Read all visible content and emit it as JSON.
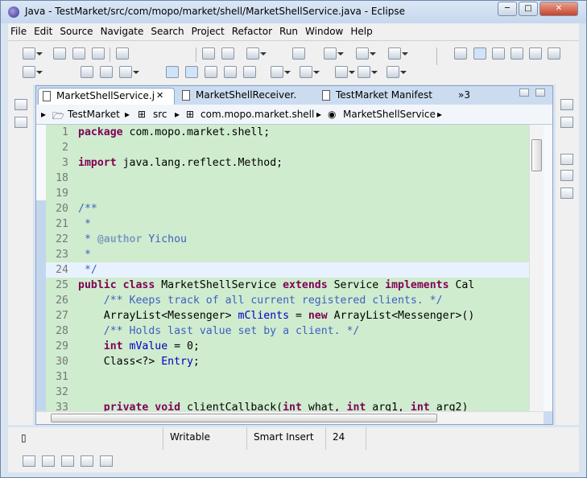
{
  "window": {
    "title": "Java - TestMarket/src/com/mopo/market/shell/MarketShellService.java - Eclipse",
    "min": "─",
    "max": "□",
    "close": "✕"
  },
  "menu": [
    "File",
    "Edit",
    "Source",
    "Navigate",
    "Search",
    "Project",
    "Refactor",
    "Run",
    "Window",
    "Help"
  ],
  "tabs": [
    {
      "label": "MarketShellService.j",
      "close": "✕"
    },
    {
      "label": "MarketShellReceiver."
    },
    {
      "label": "TestMarket Manifest"
    },
    {
      "label": "»3"
    }
  ],
  "breadcrumb": [
    "TestMarket",
    "src",
    "com.mopo.market.shell",
    "MarketShellService"
  ],
  "code": [
    {
      "n": "1",
      "t": "package com.mopo.market.shell;"
    },
    {
      "n": "2",
      "t": ""
    },
    {
      "n": "3",
      "t": "import java.lang.reflect.Method;"
    },
    {
      "n": "18",
      "t": ""
    },
    {
      "n": "19",
      "t": ""
    },
    {
      "n": "20",
      "t": "/**"
    },
    {
      "n": "21",
      "t": " *"
    },
    {
      "n": "22",
      "t": " * @author Yichou"
    },
    {
      "n": "23",
      "t": " *"
    },
    {
      "n": "24",
      "t": " */"
    },
    {
      "n": "25",
      "t": "public class MarketShellService extends Service implements Cal"
    },
    {
      "n": "26",
      "t": "    /** Keeps track of all current registered clients. */"
    },
    {
      "n": "27",
      "t": "    ArrayList<Messenger> mClients = new ArrayList<Messenger>()"
    },
    {
      "n": "28",
      "t": "    /** Holds last value set by a client. */"
    },
    {
      "n": "29",
      "t": "    int mValue = 0;"
    },
    {
      "n": "30",
      "t": "    Class<?> Entry;"
    },
    {
      "n": "31",
      "t": ""
    },
    {
      "n": "32",
      "t": ""
    },
    {
      "n": "33",
      "t": "    private void clientCallback(int what, int arg1, int arg2) "
    }
  ],
  "status": {
    "writable": "Writable",
    "insert_mode": "Smart Insert",
    "position": "24"
  },
  "colors": {
    "code_bg": "#cfeccf",
    "keyword": "#7f0055",
    "comment": "#3f5fbf",
    "field": "#0000c0"
  }
}
